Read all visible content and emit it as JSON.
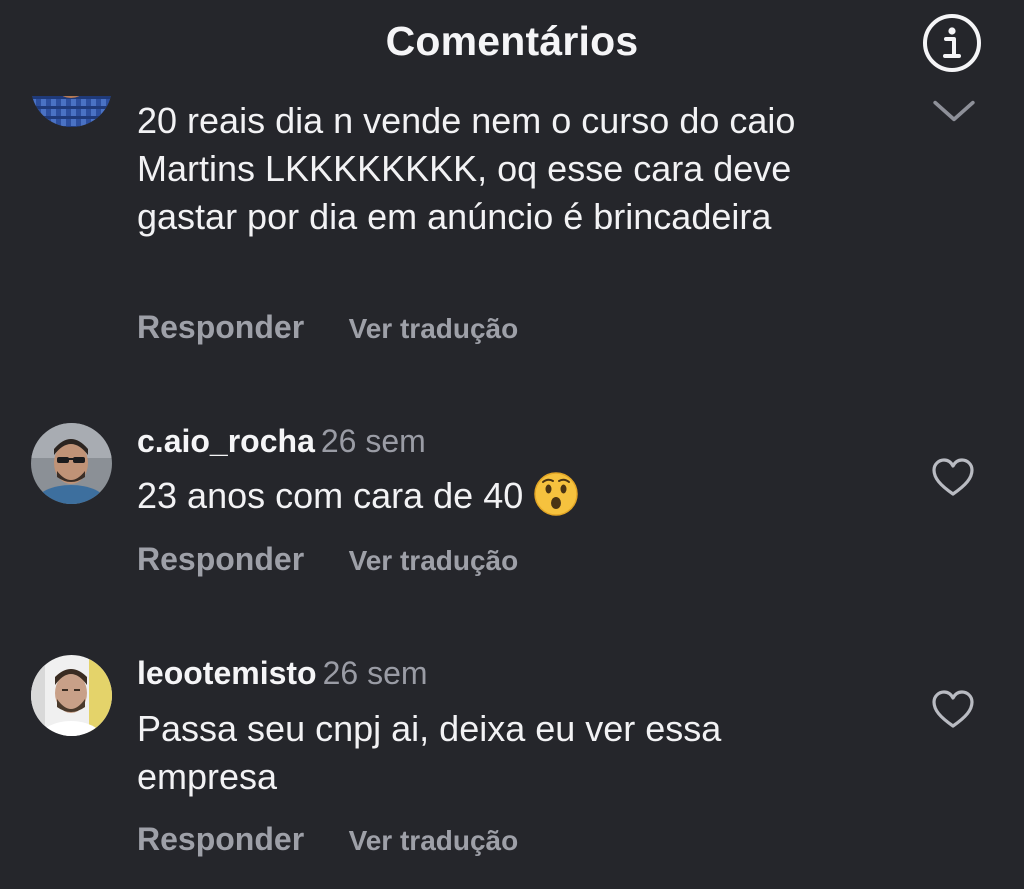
{
  "header": {
    "title": "Comentários",
    "info_icon": "info-icon"
  },
  "comments": [
    {
      "username": "",
      "time": "",
      "text": "20 reais dia n vende nem o curso do caio Martins LKKKKKKKK, oq esse cara deve gastar por dia em anúncio é brincadeira",
      "reply_label": "Responder",
      "translate_label": "Ver tradução",
      "avatar_icon": "user-avatar"
    },
    {
      "username": "c.aio_rocha",
      "time": "26 sem",
      "text": "23 anos com cara de 40",
      "emoji": "astonished-face-emoji",
      "reply_label": "Responder",
      "translate_label": "Ver tradução",
      "avatar_icon": "user-avatar"
    },
    {
      "username": "leootemisto",
      "time": "26 sem",
      "text": "Passa seu cnpj ai, deixa eu ver essa empresa",
      "reply_label": "Responder",
      "translate_label": "Ver tradução",
      "avatar_icon": "user-avatar"
    }
  ],
  "colors": {
    "background": "#25262b",
    "text": "#f2f2f4",
    "muted": "#9ea0a8"
  }
}
